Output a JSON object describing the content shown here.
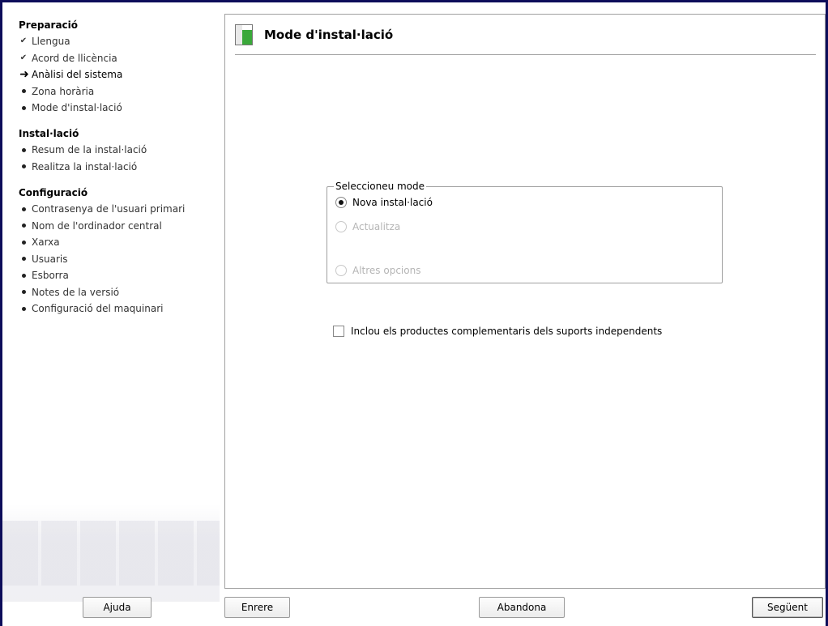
{
  "sidebar": {
    "sections": [
      {
        "title": "Preparació",
        "steps": [
          {
            "label": "Llengua",
            "state": "done"
          },
          {
            "label": "Acord de llicència",
            "state": "done"
          },
          {
            "label": "Anàlisi del sistema",
            "state": "current"
          },
          {
            "label": "Zona horària",
            "state": "pending"
          },
          {
            "label": "Mode d'instal·lació",
            "state": "pending"
          }
        ]
      },
      {
        "title": "Instal·lació",
        "steps": [
          {
            "label": "Resum de la instal·lació",
            "state": "pending"
          },
          {
            "label": "Realitza la instal·lació",
            "state": "pending"
          }
        ]
      },
      {
        "title": "Configuració",
        "steps": [
          {
            "label": "Contrasenya de l'usuari primari",
            "state": "pending"
          },
          {
            "label": "Nom de l'ordinador central",
            "state": "pending"
          },
          {
            "label": "Xarxa",
            "state": "pending"
          },
          {
            "label": "Usuaris",
            "state": "pending"
          },
          {
            "label": "Esborra",
            "state": "pending"
          },
          {
            "label": "Notes de la versió",
            "state": "pending"
          },
          {
            "label": "Configuració del maquinari",
            "state": "pending"
          }
        ]
      }
    ],
    "marks": {
      "done": "✔",
      "current": "➜"
    }
  },
  "main": {
    "title": "Mode d'instal·lació",
    "mode_group": {
      "label": "Seleccioneu mode",
      "options": [
        {
          "label": "Nova instal·lació",
          "selected": true,
          "enabled": true
        },
        {
          "label": "Actualitza",
          "selected": false,
          "enabled": false
        },
        {
          "label": "Altres opcions",
          "selected": false,
          "enabled": false
        }
      ]
    },
    "addon_checkbox": {
      "label": "Inclou els productes complementaris dels suports independents",
      "checked": false
    }
  },
  "buttons": {
    "help": "Ajuda",
    "back": "Enrere",
    "abort": "Abandona",
    "next": "Següent"
  },
  "colors": {
    "frame": "#0d0d5a",
    "icon_green": "#3aa83a"
  }
}
